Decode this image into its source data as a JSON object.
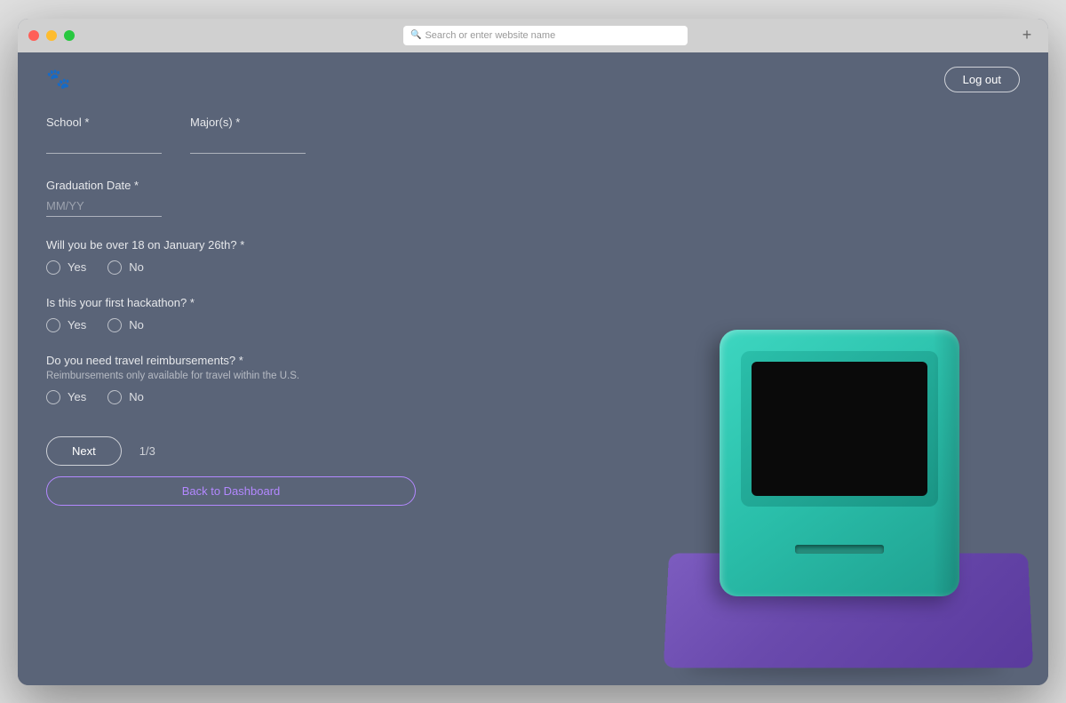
{
  "browser": {
    "address_placeholder": "Search or enter website name",
    "new_tab_symbol": "+"
  },
  "header": {
    "logo_symbol": "🐾",
    "logout_label": "Log out"
  },
  "form": {
    "school_label": "School *",
    "school_placeholder": "",
    "majors_label": "Major(s) *",
    "majors_placeholder": "",
    "graduation_label": "Graduation Date *",
    "graduation_placeholder": "MM/YY",
    "age_question": "Will you be over 18 on January 26th? *",
    "age_yes": "Yes",
    "age_no": "No",
    "hackathon_question": "Is this your first hackathon? *",
    "hackathon_yes": "Yes",
    "hackathon_no": "No",
    "travel_question": "Do you need travel reimbursements? *",
    "travel_subtext": "Reimbursements only available for travel within the U.S.",
    "travel_yes": "Yes",
    "travel_no": "No"
  },
  "buttons": {
    "next_label": "Next",
    "page_indicator": "1/3",
    "dashboard_label": "Back to Dashboard"
  }
}
